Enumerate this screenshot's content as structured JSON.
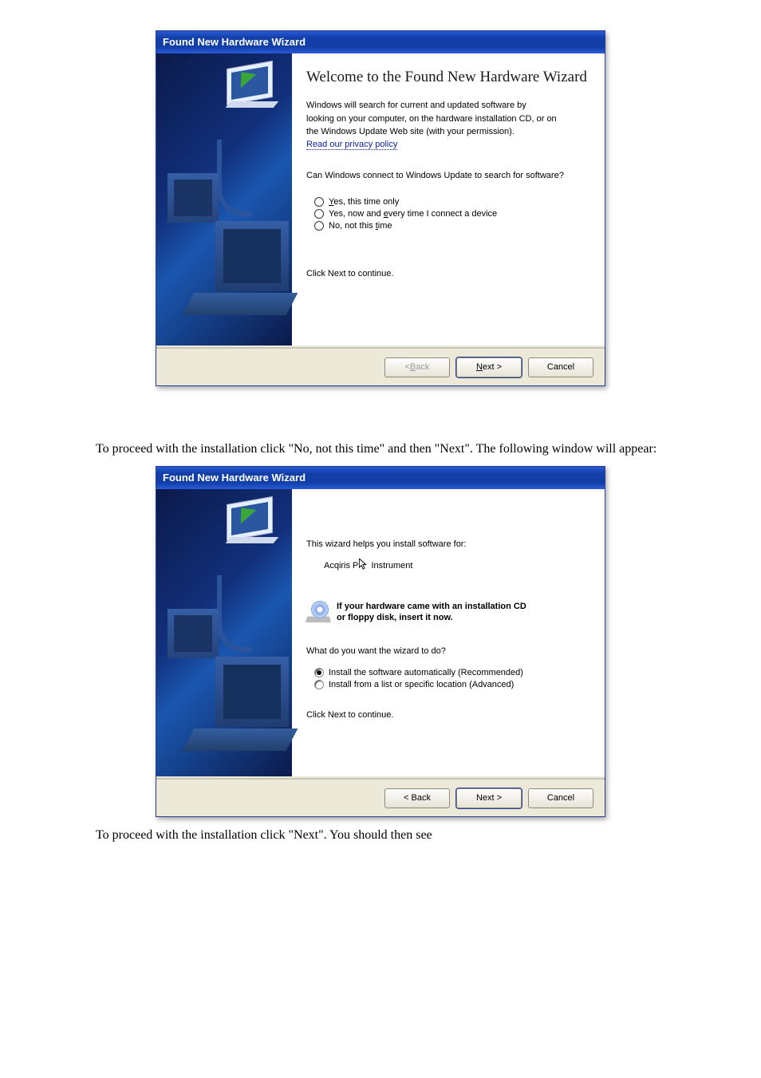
{
  "caption1": "To proceed with the installation click \"No, not this time\" and then \"Next\". The following window will appear:",
  "caption2": "To proceed with the installation click \"Next\".  You should then see",
  "wizard1": {
    "title": "Found New Hardware Wizard",
    "heading": "Welcome to the Found New Hardware Wizard",
    "intro_line1": "Windows will search for current and updated software by",
    "intro_line2": "looking on your computer, on the hardware installation CD, or on",
    "intro_line3": "the Windows Update Web site (with your permission).",
    "privacy_link": "Read our privacy policy",
    "question": "Can Windows connect to Windows Update to search for software?",
    "opt_yes_pre": "Y",
    "opt_yes_post": "es, this time only",
    "opt_every_pre": "Yes, now and ",
    "opt_every_key": "e",
    "opt_every_post": "very time I connect a device",
    "opt_no_pre": "No, not this ",
    "opt_no_key": "t",
    "opt_no_post": "ime",
    "continue": "Click Next to continue.",
    "back_pre": "< ",
    "back_key": "B",
    "back_post": "ack",
    "next_key": "N",
    "next_post": "ext >",
    "cancel": "Cancel"
  },
  "wizard2": {
    "title": "Found New Hardware Wizard",
    "intro": "This wizard helps you install software for:",
    "device_pre": "Acqiris P",
    "device_post": " Instrument",
    "cd_line1": "If your hardware came with an installation CD",
    "cd_line2": "or floppy disk, insert it now.",
    "question": "What do you want the wizard to do?",
    "opt_auto": "Install the software automatically (Recommended)",
    "opt_list": "Install from a list or specific location (Advanced)",
    "continue": "Click Next to continue.",
    "back": "< Back",
    "next": "Next >",
    "cancel": "Cancel"
  }
}
